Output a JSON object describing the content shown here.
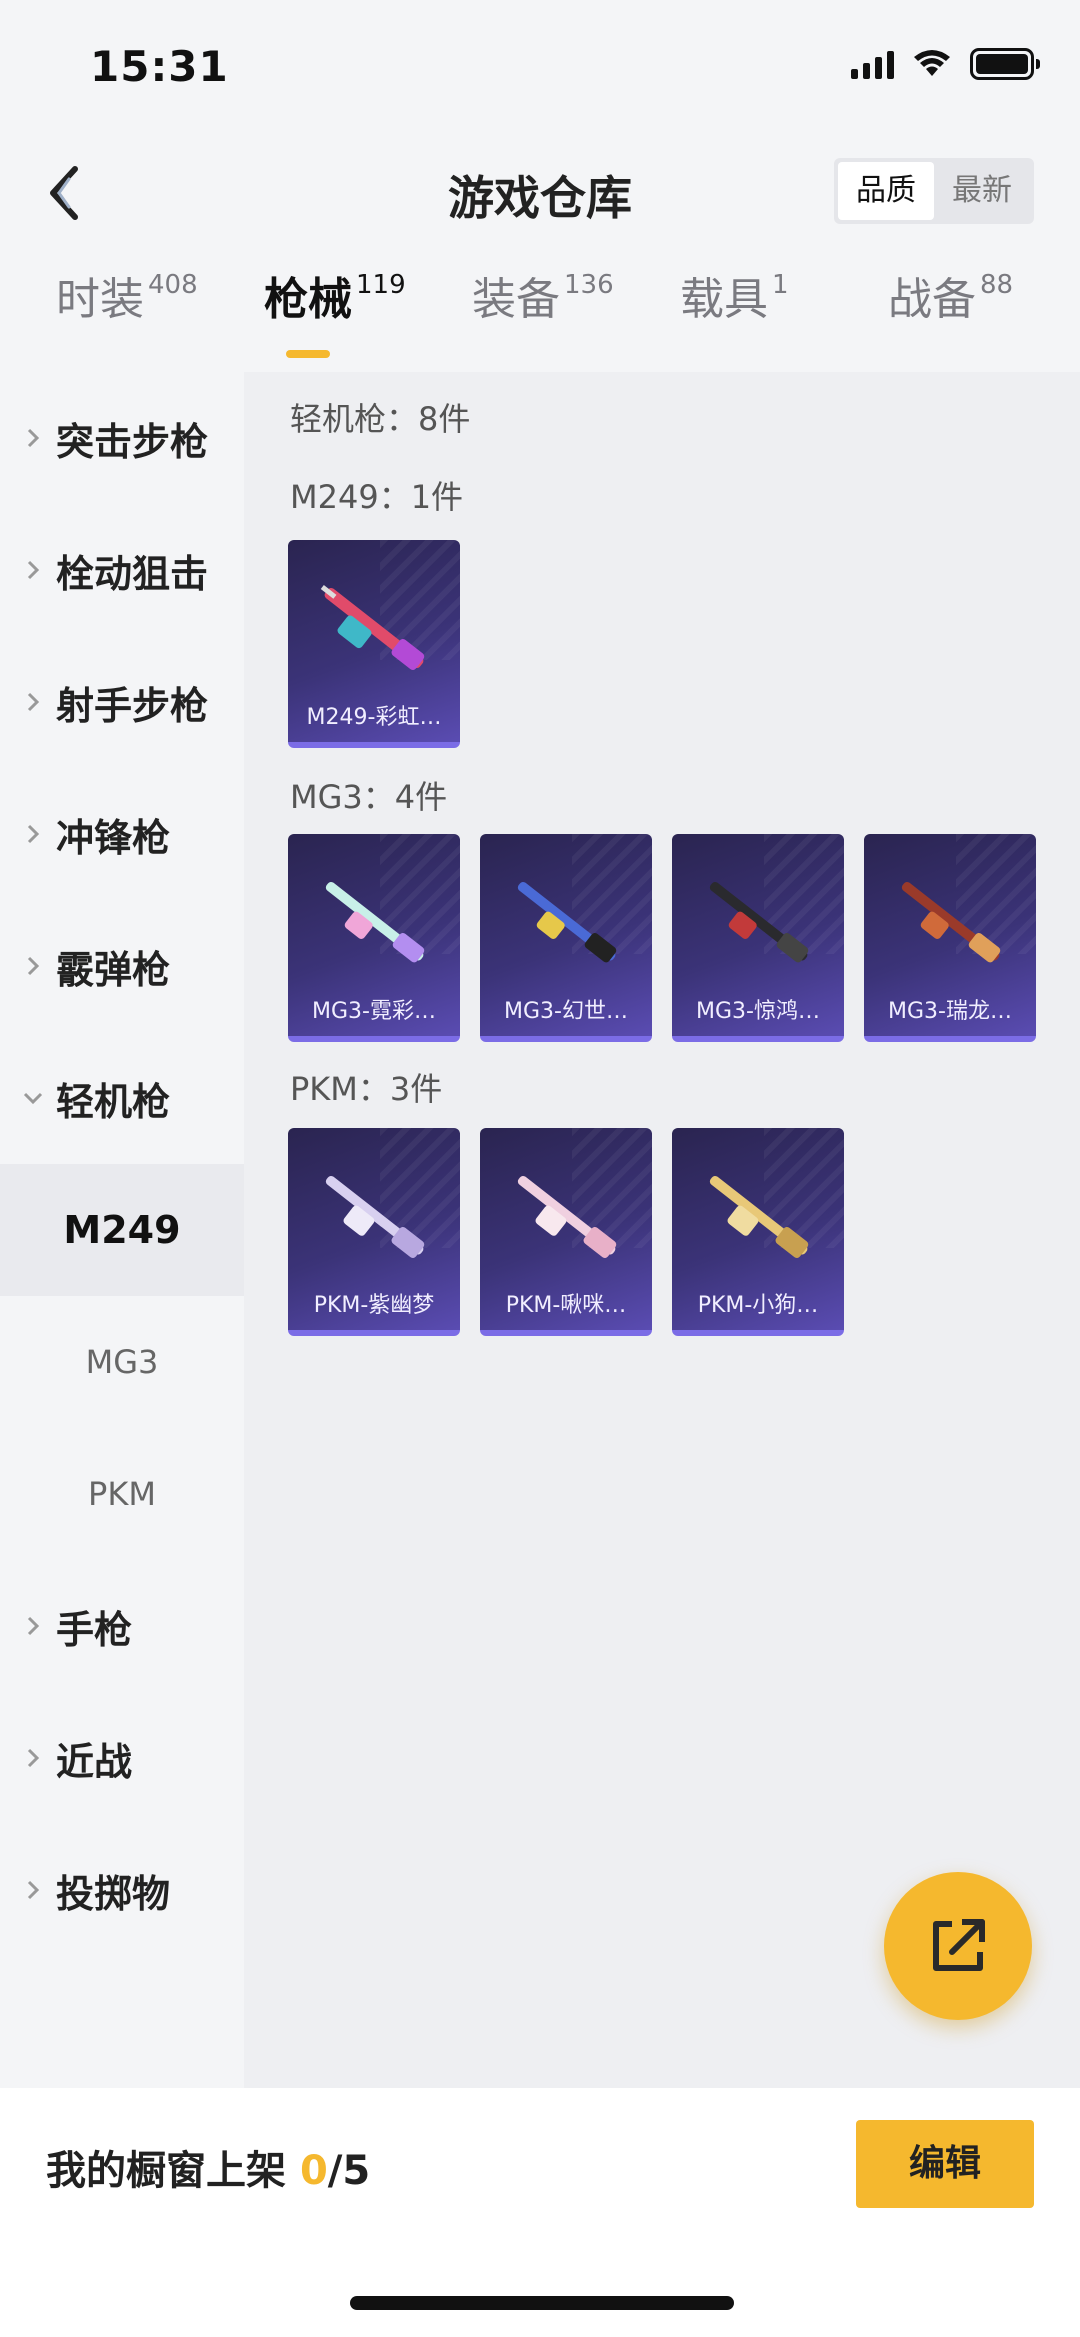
{
  "status_bar": {
    "time": "15:31"
  },
  "header": {
    "title": "游戏仓库",
    "sort_options": [
      "品质",
      "最新"
    ],
    "sort_selected": "品质"
  },
  "tabs": [
    {
      "label": "时装",
      "count": "408"
    },
    {
      "label": "枪械",
      "count": "119"
    },
    {
      "label": "装备",
      "count": "136"
    },
    {
      "label": "载具",
      "count": "1"
    },
    {
      "label": "战备",
      "count": "88"
    }
  ],
  "active_tab": "枪械",
  "sidebar": {
    "categories": [
      "突击步枪",
      "栓动狙击",
      "射手步枪",
      "冲锋枪",
      "霰弹枪",
      "轻机枪",
      "手枪",
      "近战",
      "投掷物"
    ],
    "expanded_category": "轻机枪",
    "subitems": [
      "M249",
      "MG3",
      "PKM"
    ],
    "selected_subitem": "M249"
  },
  "content": {
    "summary": "轻机枪：8件",
    "groups": [
      {
        "title": "M249：1件",
        "items": [
          "M249-彩虹…"
        ]
      },
      {
        "title": "MG3：4件",
        "items": [
          "MG3-霓彩…",
          "MG3-幻世…",
          "MG3-惊鸿…",
          "MG3-瑞龙…"
        ]
      },
      {
        "title": "PKM：3件",
        "items": [
          "PKM-紫幽梦",
          "PKM-啾咪…",
          "PKM-小狗…"
        ]
      }
    ]
  },
  "bottom": {
    "shelf_label": "我的橱窗上架",
    "shelf_current": "0",
    "shelf_total": "/5",
    "edit_label": "编辑"
  },
  "colors": {
    "accent": "#f5b82e",
    "card_bg": "#3b3378",
    "card_border": "#7b6ce6"
  },
  "icons": {
    "back": "chevron-left-icon",
    "share": "share-external-icon",
    "category": "chevron-right-icon",
    "expanded": "chevron-down-icon"
  }
}
